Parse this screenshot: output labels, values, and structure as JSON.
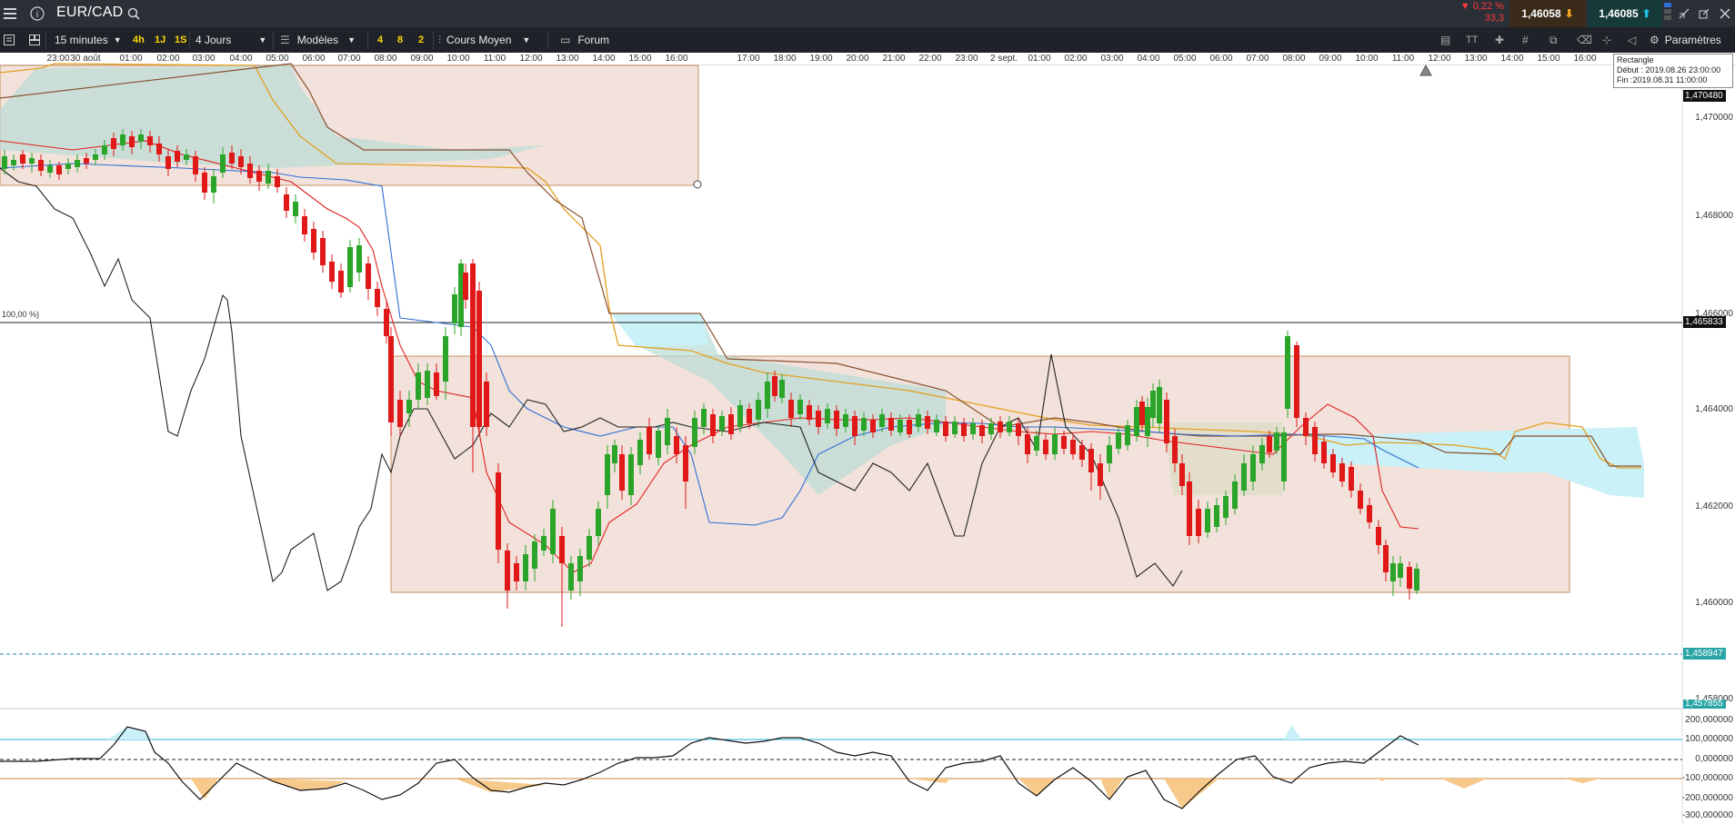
{
  "header": {
    "symbol": "EUR/CAD",
    "change_pct": "▼ 0,22 %",
    "change_pts": "33,3",
    "bid": "1,46058",
    "ask": "1,46085"
  },
  "toolbar": {
    "interval": "15 minutes",
    "quick_intervals": [
      "4h",
      "1J",
      "1S"
    ],
    "range": "4 Jours",
    "models_label": "Modèles",
    "layout_counts": [
      "4",
      "8",
      "2"
    ],
    "price_type": "Cours Moyen",
    "forum_label": "Forum",
    "settings_label": "Paramètres"
  },
  "time_axis": [
    "23:00",
    "30 août",
    "01:00",
    "02:00",
    "03:00",
    "04:00",
    "05:00",
    "06:00",
    "07:00",
    "08:00",
    "09:00",
    "10:00",
    "11:00",
    "12:00",
    "13:00",
    "14:00",
    "15:00",
    "16:00",
    "17:00",
    "18:00",
    "19:00",
    "20:00",
    "21:00",
    "22:00",
    "23:00",
    "2 sept.",
    "01:00",
    "02:00",
    "03:00",
    "04:00",
    "05:00",
    "06:00",
    "07:00",
    "08:00",
    "09:00",
    "10:00",
    "11:00",
    "12:00",
    "13:00",
    "14:00",
    "15:00",
    "16:00"
  ],
  "price_axis": [
    "1,470000",
    "1,468000",
    "1,466000",
    "1,464000",
    "1,462000",
    "1,460000",
    "1,458000"
  ],
  "price_tags": {
    "top": "1,470480",
    "level": "1,465833",
    "dashed": "1,458947",
    "bottom": "1,457855"
  },
  "fib_label": "100,00 %)",
  "tooltip": {
    "title": "Rectangle",
    "start": "Début : 2019.08.26 23:00:00",
    "end": "Fin :2019.08.31 11:00:00"
  },
  "cci_axis": [
    "200,000000",
    "100,000000",
    "0,000000",
    "-100,000000",
    "-200,000000",
    "-300,000000"
  ],
  "colors": {
    "bull": "#2aa52a",
    "bear": "#e01818",
    "tenkan": "#e02020",
    "kijun": "#2f6fd6",
    "chikou": "#222222",
    "span": "#e3a020",
    "cloud_green": "#b9ddd6",
    "cloud_blue": "#c9f1f7",
    "rectangle": "#f2e2db"
  }
}
